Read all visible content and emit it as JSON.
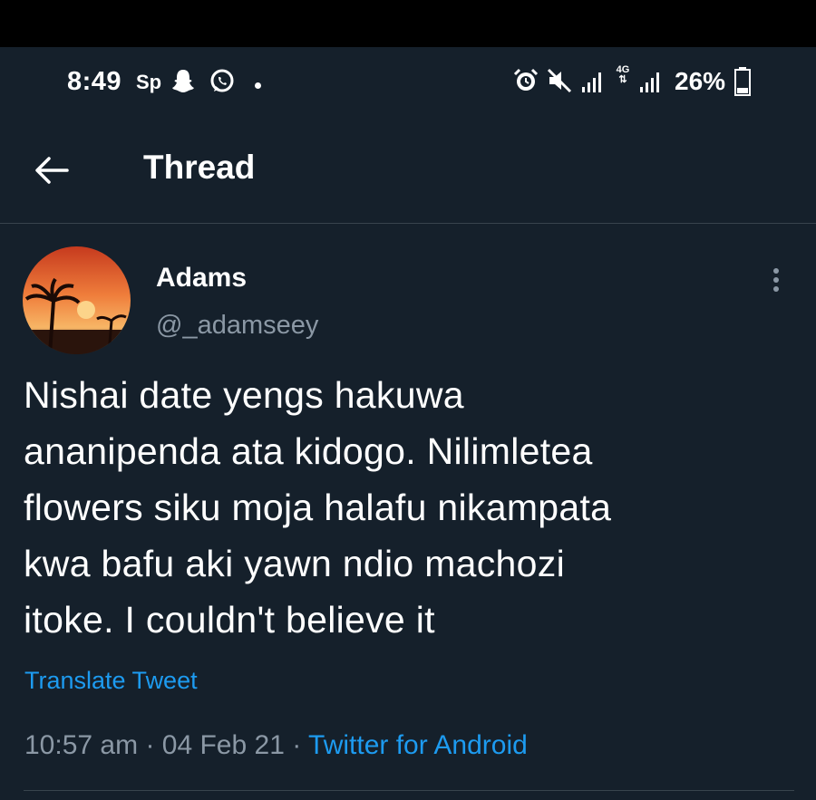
{
  "status_bar": {
    "time": "8:49",
    "carrier": "Sp",
    "network": "4G",
    "battery": "26%",
    "icons": [
      "snapchat-icon",
      "whatsapp-icon",
      "alarm-icon",
      "mute-icon",
      "signal-icon",
      "battery-icon"
    ]
  },
  "header": {
    "title": "Thread",
    "back_icon": "arrow-left-icon"
  },
  "tweet": {
    "display_name": "Adams",
    "handle": "@_adamseey",
    "text_lines": [
      "Nishai date yengs hakuwa",
      "ananipenda ata kidogo. Nilimletea",
      "flowers siku moja halafu nikampata",
      "kwa bafu aki yawn ndio machozi",
      "itoke. I couldn't believe it"
    ],
    "translate_label": "Translate Tweet",
    "time": "10:57 am",
    "date": "04 Feb 21",
    "source": "Twitter for Android",
    "separator": "·"
  },
  "colors": {
    "background": "#15202b",
    "accent": "#1d9bf0",
    "secondary_text": "#8b98a5",
    "divider": "#38444d"
  }
}
